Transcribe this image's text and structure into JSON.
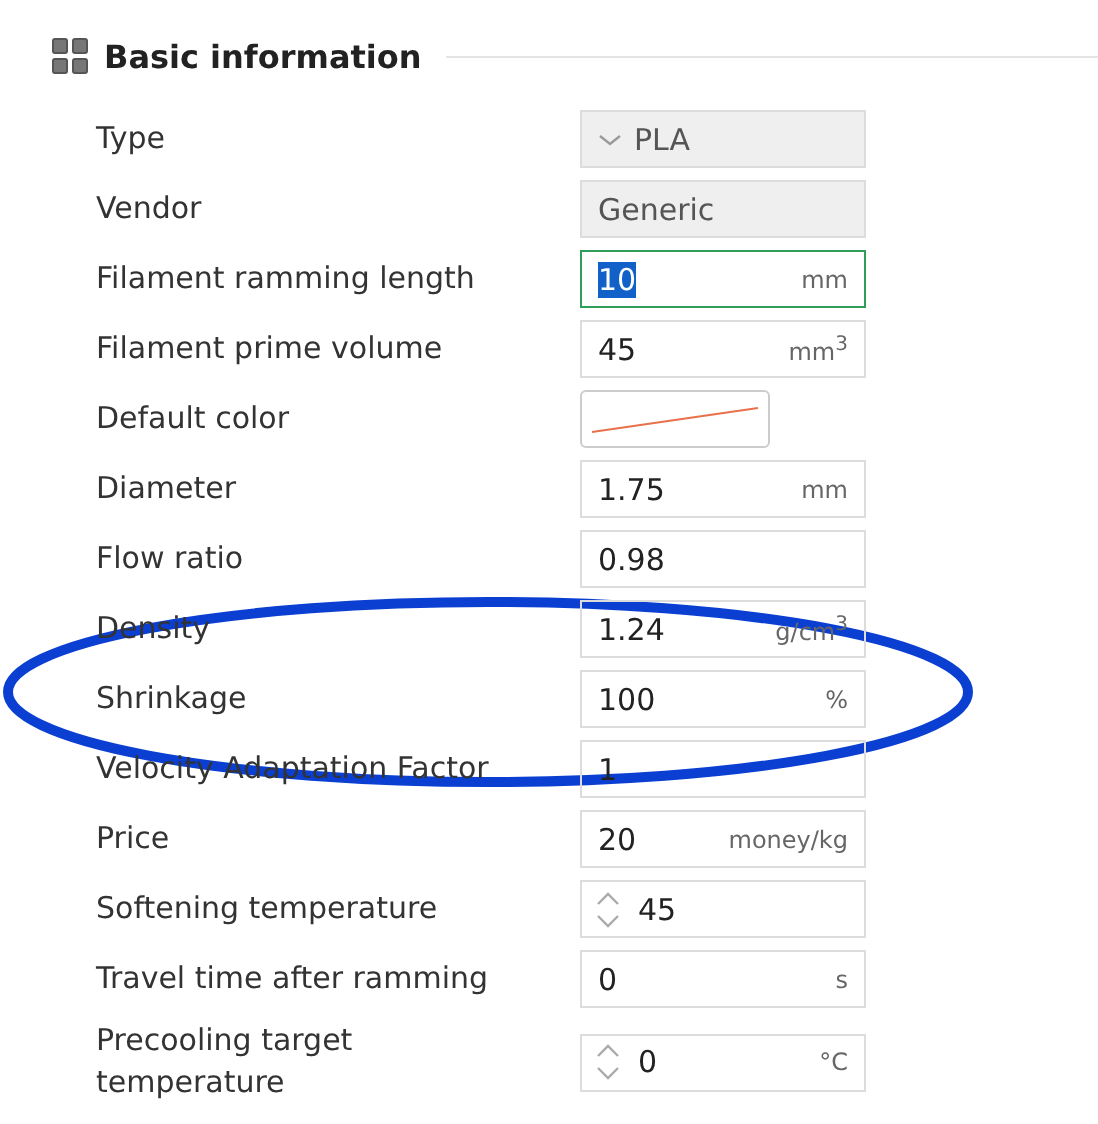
{
  "section": {
    "title": "Basic information"
  },
  "rows": [
    {
      "label": "Type",
      "kind": "combo",
      "value": "PLA",
      "focused": false
    },
    {
      "label": "Vendor",
      "kind": "readonly",
      "value": "Generic",
      "focused": false
    },
    {
      "label": "Filament ramming length",
      "kind": "text",
      "value": "10",
      "unit": "mm",
      "focused": true
    },
    {
      "label": "Filament prime volume",
      "kind": "text",
      "value": "45",
      "unit": "mm$^{3}$",
      "focused": false
    },
    {
      "label": "Default color",
      "kind": "color",
      "color": "#e8704a",
      "focused": false
    },
    {
      "label": "Diameter",
      "kind": "text",
      "value": "1.75",
      "unit": "mm",
      "focused": false
    },
    {
      "label": "Flow ratio",
      "kind": "text",
      "value": "0.98",
      "focused": false
    },
    {
      "label": "Density",
      "kind": "text",
      "value": "1.24",
      "unit": "g/cm$^{3}$",
      "focused": false
    },
    {
      "label": "Shrinkage",
      "kind": "text",
      "value": "100",
      "unit": "%",
      "focused": false
    },
    {
      "label": "Velocity Adaptation Factor",
      "kind": "text",
      "value": "1",
      "focused": false
    },
    {
      "label": "Price",
      "kind": "text",
      "value": "20",
      "unit": "money/kg",
      "focused": false
    },
    {
      "label": "Softening temperature",
      "kind": "spin",
      "value": "45",
      "focused": false
    },
    {
      "label": "Travel time after ramming",
      "kind": "text",
      "value": "0",
      "unit": "s",
      "focused": false
    },
    {
      "label": "Precooling target temperature",
      "kind": "spin",
      "value": "0",
      "unit": "°C",
      "focused": false
    }
  ]
}
